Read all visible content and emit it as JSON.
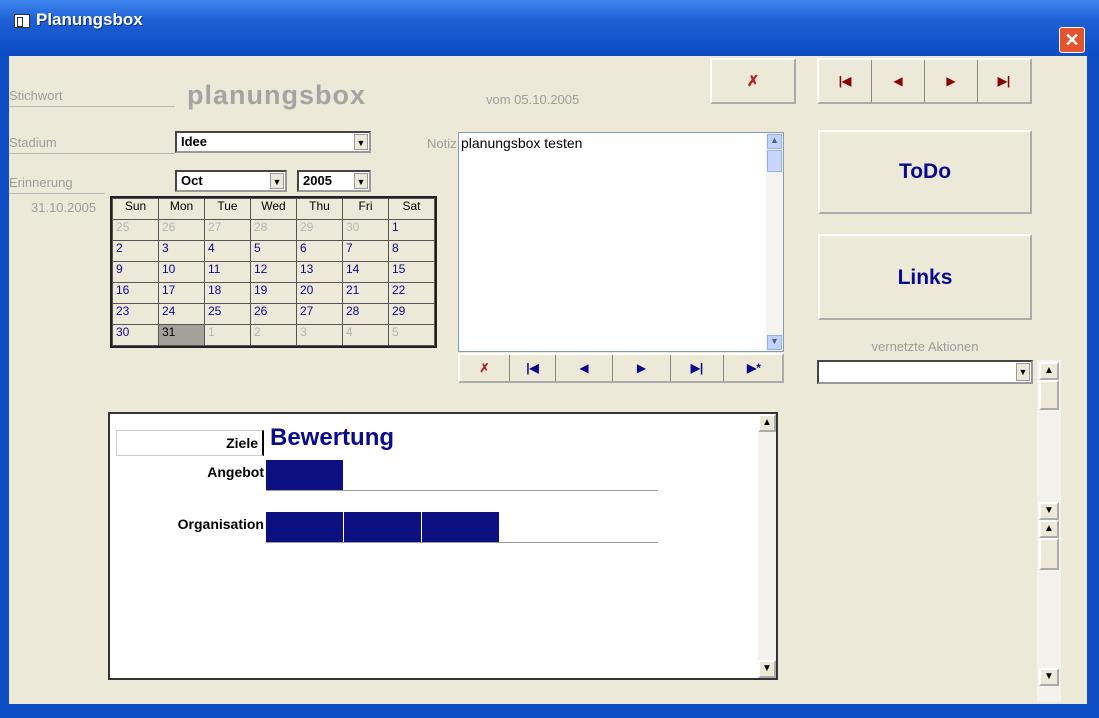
{
  "window": {
    "title": "Planungsbox",
    "close_glyph": "✕"
  },
  "form": {
    "stichwort_label": "Stichwort",
    "stichwort_value": "planungsbox",
    "vom_label": "vom 05.10.2005",
    "stadium_label": "Stadium",
    "stadium_value": "Idee",
    "notiz_label": "Notiz",
    "notiz_value": "planungsbox testen",
    "erinnerung_label": "Erinnerung",
    "erinnerung_date": "31.10.2005",
    "month_value": "Oct",
    "year_value": "2005"
  },
  "calendar": {
    "weekdays": [
      "Sun",
      "Mon",
      "Tue",
      "Wed",
      "Thu",
      "Fri",
      "Sat"
    ],
    "weeks": [
      [
        "25",
        "26",
        "27",
        "28",
        "29",
        "30",
        "1"
      ],
      [
        "2",
        "3",
        "4",
        "5",
        "6",
        "7",
        "8"
      ],
      [
        "9",
        "10",
        "11",
        "12",
        "13",
        "14",
        "15"
      ],
      [
        "16",
        "17",
        "18",
        "19",
        "20",
        "21",
        "22"
      ],
      [
        "23",
        "24",
        "25",
        "26",
        "27",
        "28",
        "29"
      ],
      [
        "30",
        "31",
        "1",
        "2",
        "3",
        "4",
        "5"
      ]
    ],
    "dim_cells": [
      [
        0,
        0
      ],
      [
        0,
        1
      ],
      [
        0,
        2
      ],
      [
        0,
        3
      ],
      [
        0,
        4
      ],
      [
        0,
        5
      ],
      [
        5,
        2
      ],
      [
        5,
        3
      ],
      [
        5,
        4
      ],
      [
        5,
        5
      ],
      [
        5,
        6
      ]
    ],
    "selected_cell": [
      5,
      1
    ]
  },
  "buttons": {
    "todo": "ToDo",
    "links": "Links"
  },
  "vernetzte_label": "vernetzte Aktionen",
  "rating": {
    "ziele_label": "Ziele",
    "title": "Bewertung",
    "rows": [
      {
        "label": "Angebot",
        "level": 1,
        "max": 5
      },
      {
        "label": "Organisation",
        "level": 3,
        "max": 5
      }
    ]
  },
  "colors": {
    "accent": "#0a0a8c",
    "rating_bar": "#0c1080",
    "window_blue": "#0d4ec4"
  },
  "icons": {
    "delete": "delete-record-icon",
    "first": "first-record-icon",
    "prev": "prev-record-icon",
    "next": "next-record-icon",
    "last": "last-record-icon",
    "new": "new-record-icon"
  }
}
